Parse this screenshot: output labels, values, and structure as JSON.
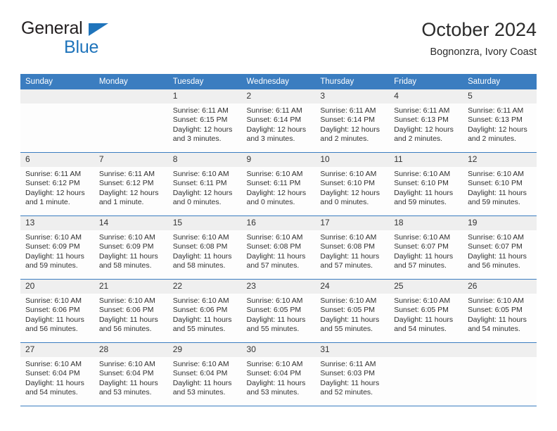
{
  "brand": {
    "name_top": "General",
    "name_bottom": "Blue",
    "triangle_icon": "blue-triangle-icon",
    "accent_color": "#1f74bb"
  },
  "header": {
    "title": "October 2024",
    "subtitle": "Bognonzra, Ivory Coast"
  },
  "colors": {
    "header_blue": "#3b7dc0",
    "daynum_gray": "#efefef",
    "cell_bg": "#fdfdfd"
  },
  "weekday_headers": [
    "Sunday",
    "Monday",
    "Tuesday",
    "Wednesday",
    "Thursday",
    "Friday",
    "Saturday"
  ],
  "weeks": [
    [
      {
        "day": "",
        "sunrise": "",
        "sunset": "",
        "daylight1": "",
        "daylight2": ""
      },
      {
        "day": "",
        "sunrise": "",
        "sunset": "",
        "daylight1": "",
        "daylight2": ""
      },
      {
        "day": "1",
        "sunrise": "Sunrise: 6:11 AM",
        "sunset": "Sunset: 6:15 PM",
        "daylight1": "Daylight: 12 hours",
        "daylight2": "and 3 minutes."
      },
      {
        "day": "2",
        "sunrise": "Sunrise: 6:11 AM",
        "sunset": "Sunset: 6:14 PM",
        "daylight1": "Daylight: 12 hours",
        "daylight2": "and 3 minutes."
      },
      {
        "day": "3",
        "sunrise": "Sunrise: 6:11 AM",
        "sunset": "Sunset: 6:14 PM",
        "daylight1": "Daylight: 12 hours",
        "daylight2": "and 2 minutes."
      },
      {
        "day": "4",
        "sunrise": "Sunrise: 6:11 AM",
        "sunset": "Sunset: 6:13 PM",
        "daylight1": "Daylight: 12 hours",
        "daylight2": "and 2 minutes."
      },
      {
        "day": "5",
        "sunrise": "Sunrise: 6:11 AM",
        "sunset": "Sunset: 6:13 PM",
        "daylight1": "Daylight: 12 hours",
        "daylight2": "and 2 minutes."
      }
    ],
    [
      {
        "day": "6",
        "sunrise": "Sunrise: 6:11 AM",
        "sunset": "Sunset: 6:12 PM",
        "daylight1": "Daylight: 12 hours",
        "daylight2": "and 1 minute."
      },
      {
        "day": "7",
        "sunrise": "Sunrise: 6:11 AM",
        "sunset": "Sunset: 6:12 PM",
        "daylight1": "Daylight: 12 hours",
        "daylight2": "and 1 minute."
      },
      {
        "day": "8",
        "sunrise": "Sunrise: 6:10 AM",
        "sunset": "Sunset: 6:11 PM",
        "daylight1": "Daylight: 12 hours",
        "daylight2": "and 0 minutes."
      },
      {
        "day": "9",
        "sunrise": "Sunrise: 6:10 AM",
        "sunset": "Sunset: 6:11 PM",
        "daylight1": "Daylight: 12 hours",
        "daylight2": "and 0 minutes."
      },
      {
        "day": "10",
        "sunrise": "Sunrise: 6:10 AM",
        "sunset": "Sunset: 6:10 PM",
        "daylight1": "Daylight: 12 hours",
        "daylight2": "and 0 minutes."
      },
      {
        "day": "11",
        "sunrise": "Sunrise: 6:10 AM",
        "sunset": "Sunset: 6:10 PM",
        "daylight1": "Daylight: 11 hours",
        "daylight2": "and 59 minutes."
      },
      {
        "day": "12",
        "sunrise": "Sunrise: 6:10 AM",
        "sunset": "Sunset: 6:10 PM",
        "daylight1": "Daylight: 11 hours",
        "daylight2": "and 59 minutes."
      }
    ],
    [
      {
        "day": "13",
        "sunrise": "Sunrise: 6:10 AM",
        "sunset": "Sunset: 6:09 PM",
        "daylight1": "Daylight: 11 hours",
        "daylight2": "and 59 minutes."
      },
      {
        "day": "14",
        "sunrise": "Sunrise: 6:10 AM",
        "sunset": "Sunset: 6:09 PM",
        "daylight1": "Daylight: 11 hours",
        "daylight2": "and 58 minutes."
      },
      {
        "day": "15",
        "sunrise": "Sunrise: 6:10 AM",
        "sunset": "Sunset: 6:08 PM",
        "daylight1": "Daylight: 11 hours",
        "daylight2": "and 58 minutes."
      },
      {
        "day": "16",
        "sunrise": "Sunrise: 6:10 AM",
        "sunset": "Sunset: 6:08 PM",
        "daylight1": "Daylight: 11 hours",
        "daylight2": "and 57 minutes."
      },
      {
        "day": "17",
        "sunrise": "Sunrise: 6:10 AM",
        "sunset": "Sunset: 6:08 PM",
        "daylight1": "Daylight: 11 hours",
        "daylight2": "and 57 minutes."
      },
      {
        "day": "18",
        "sunrise": "Sunrise: 6:10 AM",
        "sunset": "Sunset: 6:07 PM",
        "daylight1": "Daylight: 11 hours",
        "daylight2": "and 57 minutes."
      },
      {
        "day": "19",
        "sunrise": "Sunrise: 6:10 AM",
        "sunset": "Sunset: 6:07 PM",
        "daylight1": "Daylight: 11 hours",
        "daylight2": "and 56 minutes."
      }
    ],
    [
      {
        "day": "20",
        "sunrise": "Sunrise: 6:10 AM",
        "sunset": "Sunset: 6:06 PM",
        "daylight1": "Daylight: 11 hours",
        "daylight2": "and 56 minutes."
      },
      {
        "day": "21",
        "sunrise": "Sunrise: 6:10 AM",
        "sunset": "Sunset: 6:06 PM",
        "daylight1": "Daylight: 11 hours",
        "daylight2": "and 56 minutes."
      },
      {
        "day": "22",
        "sunrise": "Sunrise: 6:10 AM",
        "sunset": "Sunset: 6:06 PM",
        "daylight1": "Daylight: 11 hours",
        "daylight2": "and 55 minutes."
      },
      {
        "day": "23",
        "sunrise": "Sunrise: 6:10 AM",
        "sunset": "Sunset: 6:05 PM",
        "daylight1": "Daylight: 11 hours",
        "daylight2": "and 55 minutes."
      },
      {
        "day": "24",
        "sunrise": "Sunrise: 6:10 AM",
        "sunset": "Sunset: 6:05 PM",
        "daylight1": "Daylight: 11 hours",
        "daylight2": "and 55 minutes."
      },
      {
        "day": "25",
        "sunrise": "Sunrise: 6:10 AM",
        "sunset": "Sunset: 6:05 PM",
        "daylight1": "Daylight: 11 hours",
        "daylight2": "and 54 minutes."
      },
      {
        "day": "26",
        "sunrise": "Sunrise: 6:10 AM",
        "sunset": "Sunset: 6:05 PM",
        "daylight1": "Daylight: 11 hours",
        "daylight2": "and 54 minutes."
      }
    ],
    [
      {
        "day": "27",
        "sunrise": "Sunrise: 6:10 AM",
        "sunset": "Sunset: 6:04 PM",
        "daylight1": "Daylight: 11 hours",
        "daylight2": "and 54 minutes."
      },
      {
        "day": "28",
        "sunrise": "Sunrise: 6:10 AM",
        "sunset": "Sunset: 6:04 PM",
        "daylight1": "Daylight: 11 hours",
        "daylight2": "and 53 minutes."
      },
      {
        "day": "29",
        "sunrise": "Sunrise: 6:10 AM",
        "sunset": "Sunset: 6:04 PM",
        "daylight1": "Daylight: 11 hours",
        "daylight2": "and 53 minutes."
      },
      {
        "day": "30",
        "sunrise": "Sunrise: 6:10 AM",
        "sunset": "Sunset: 6:04 PM",
        "daylight1": "Daylight: 11 hours",
        "daylight2": "and 53 minutes."
      },
      {
        "day": "31",
        "sunrise": "Sunrise: 6:11 AM",
        "sunset": "Sunset: 6:03 PM",
        "daylight1": "Daylight: 11 hours",
        "daylight2": "and 52 minutes."
      },
      {
        "day": "",
        "sunrise": "",
        "sunset": "",
        "daylight1": "",
        "daylight2": ""
      },
      {
        "day": "",
        "sunrise": "",
        "sunset": "",
        "daylight1": "",
        "daylight2": ""
      }
    ]
  ]
}
